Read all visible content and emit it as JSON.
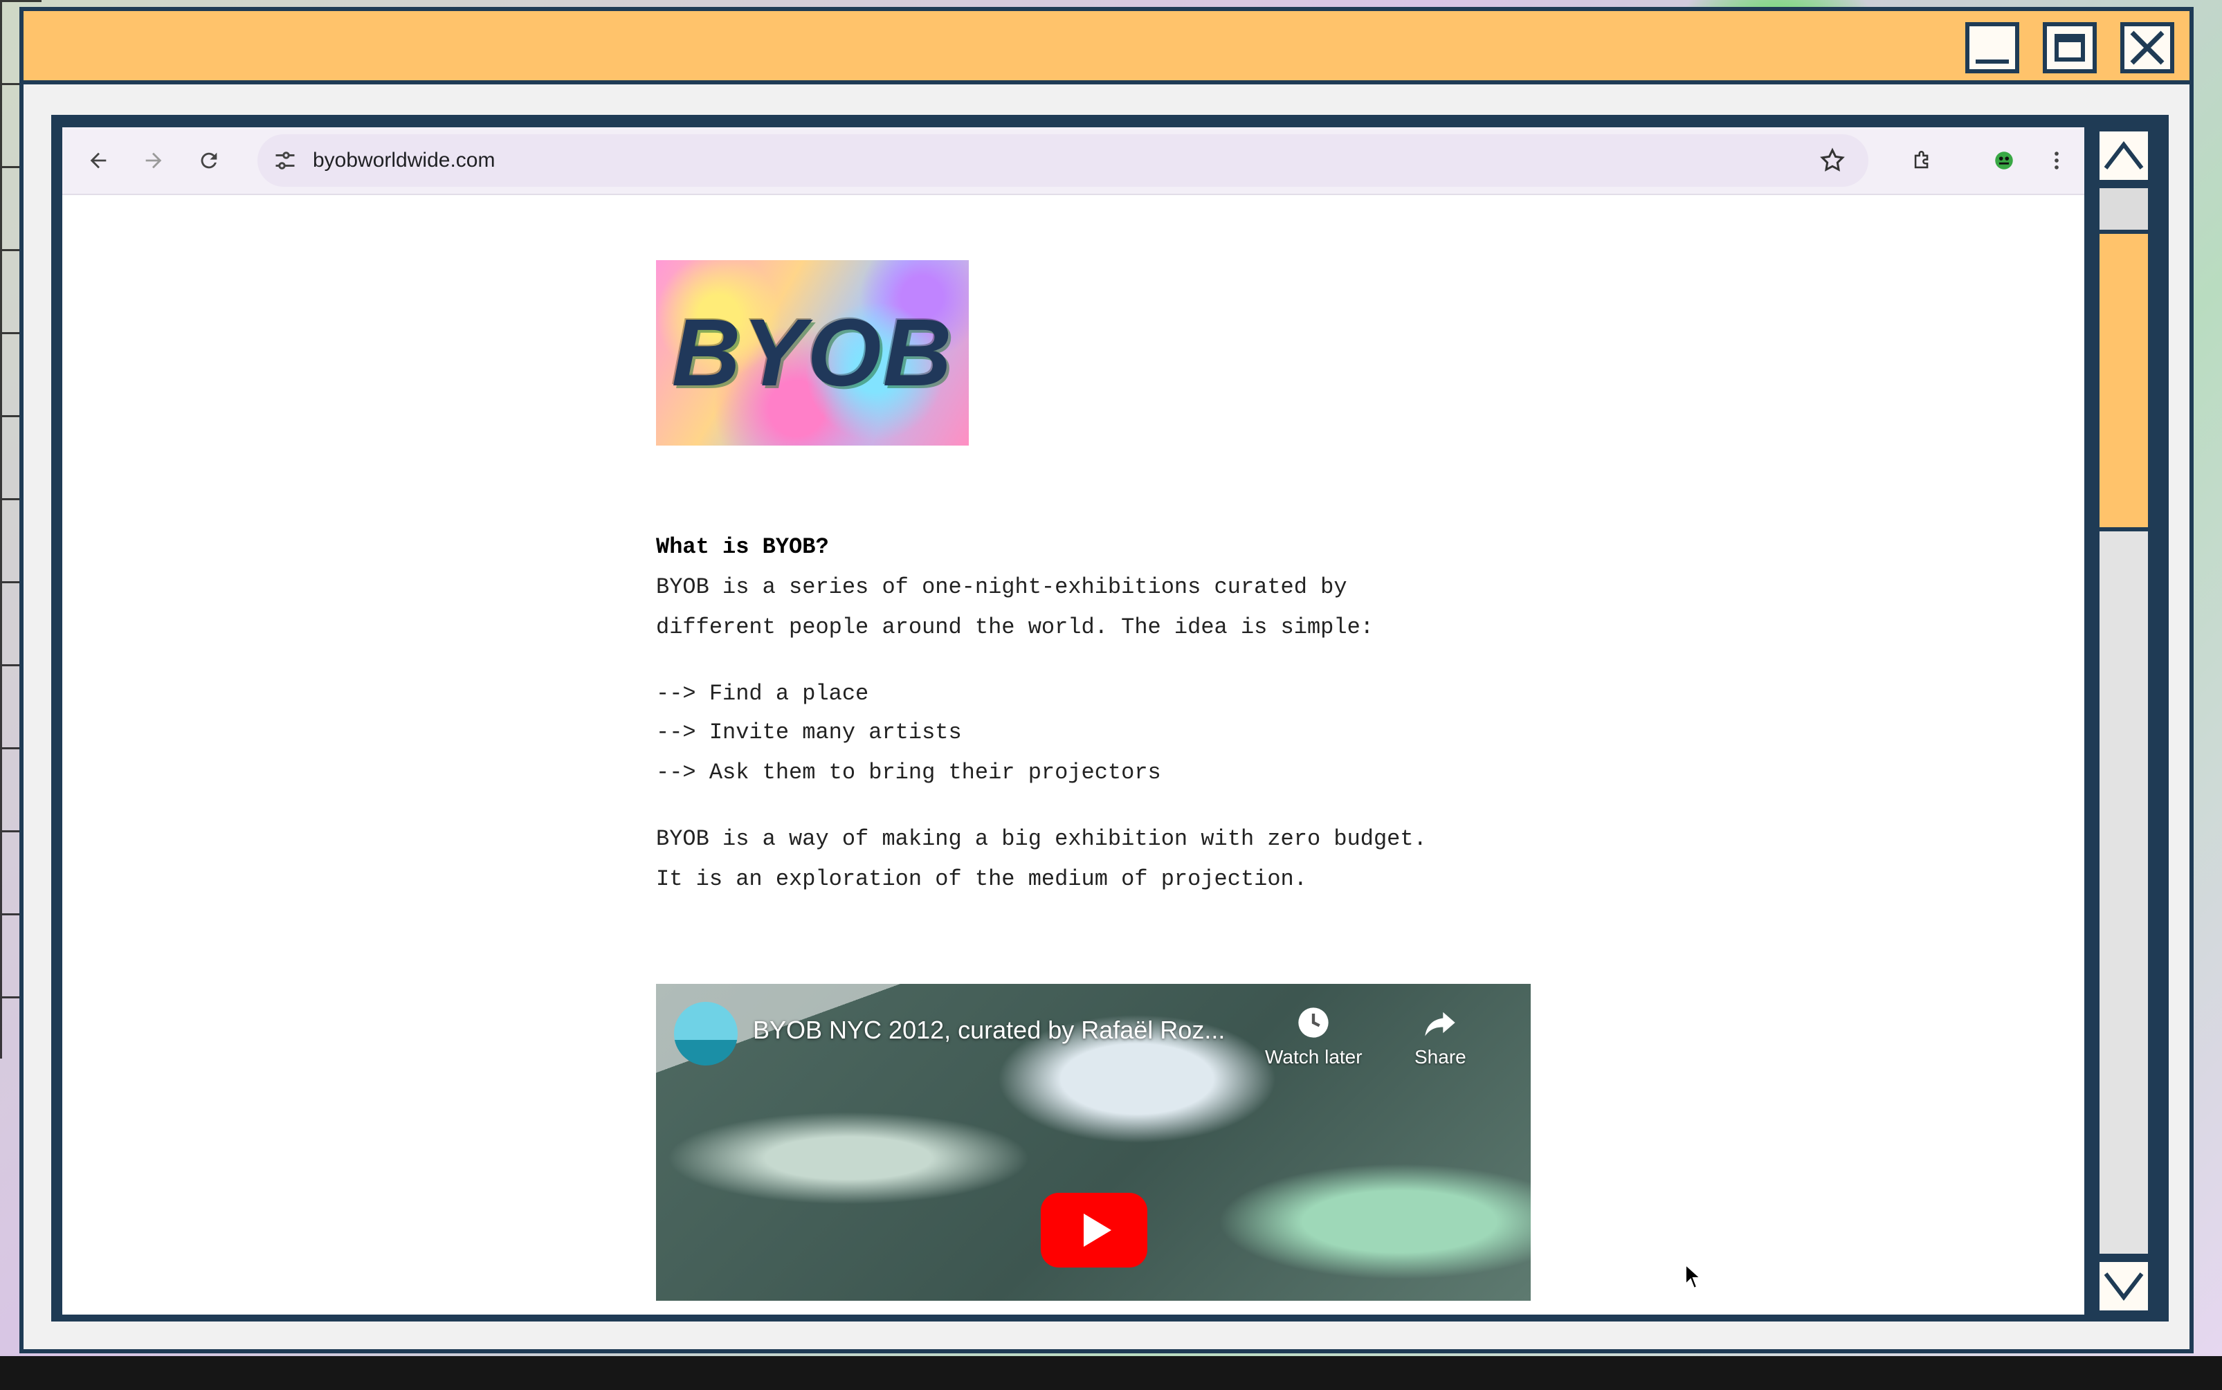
{
  "browser": {
    "url": "byobworldwide.com"
  },
  "page": {
    "logo_text": "BYOB",
    "heading": "What is BYOB?",
    "intro": [
      "BYOB is a series of one-night-exhibitions curated by",
      "different people around the world. The idea is simple:"
    ],
    "steps": [
      "--> Find a place",
      "--> Invite many artists",
      "--> Ask them to bring their projectors"
    ],
    "outro": [
      "BYOB is a way of making a big exhibition with zero budget.",
      "It is an exploration of the medium of projection."
    ]
  },
  "video": {
    "title": "BYOB NYC 2012, curated by Rafaël Roz...",
    "watch_later_label": "Watch later",
    "share_label": "Share"
  },
  "icons": {
    "back": "arrow-left-icon",
    "forward": "arrow-right-icon",
    "reload": "reload-icon",
    "site_settings": "tune-icon",
    "bookmark": "star-icon",
    "extensions": "puzzle-icon",
    "profile": "extension-avatar-icon",
    "menu": "kebab-menu-icon"
  },
  "colors": {
    "title_bar": "#ffc36b",
    "frame": "#1f3b55",
    "youtube_red": "#ff0000"
  },
  "scrollbar": {
    "thumb_fraction": 0.28
  }
}
